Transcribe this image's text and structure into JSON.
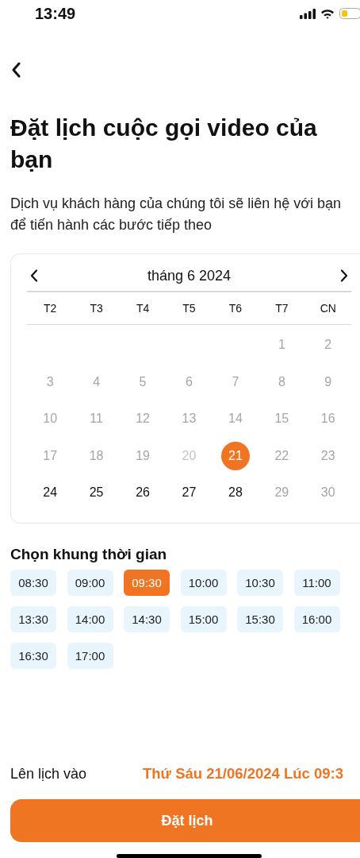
{
  "status_bar": {
    "time": "13:49"
  },
  "title": "Đặt lịch cuộc gọi video của bạn",
  "subtitle": "Dịch vụ khách hàng của chúng tôi sẽ liên hệ với bạn để tiến hành các bước tiếp theo",
  "calendar": {
    "month": "tháng 6 2024",
    "weekdays": [
      "T2",
      "T3",
      "T4",
      "T5",
      "T6",
      "T7",
      "CN"
    ],
    "days": [
      {
        "kind": "blank"
      },
      {
        "kind": "blank"
      },
      {
        "kind": "blank"
      },
      {
        "kind": "blank"
      },
      {
        "kind": "blank"
      },
      {
        "label": "1",
        "kind": "past",
        "selected": false
      },
      {
        "label": "2",
        "kind": "past",
        "selected": false
      },
      {
        "label": "3",
        "kind": "past",
        "selected": false
      },
      {
        "label": "4",
        "kind": "past",
        "selected": false
      },
      {
        "label": "5",
        "kind": "past",
        "selected": false
      },
      {
        "label": "6",
        "kind": "past",
        "selected": false
      },
      {
        "label": "7",
        "kind": "past",
        "selected": false
      },
      {
        "label": "8",
        "kind": "past",
        "selected": false
      },
      {
        "label": "9",
        "kind": "past",
        "selected": false
      },
      {
        "label": "10",
        "kind": "past",
        "selected": false
      },
      {
        "label": "11",
        "kind": "past",
        "selected": false
      },
      {
        "label": "12",
        "kind": "past",
        "selected": false
      },
      {
        "label": "13",
        "kind": "past",
        "selected": false
      },
      {
        "label": "14",
        "kind": "past",
        "selected": false
      },
      {
        "label": "15",
        "kind": "past",
        "selected": false
      },
      {
        "label": "16",
        "kind": "past",
        "selected": false
      },
      {
        "label": "17",
        "kind": "past",
        "selected": false
      },
      {
        "label": "18",
        "kind": "past",
        "selected": false
      },
      {
        "label": "19",
        "kind": "past",
        "selected": false
      },
      {
        "label": "20",
        "kind": "faint",
        "selected": false
      },
      {
        "label": "21",
        "kind": "open",
        "selected": true
      },
      {
        "label": "22",
        "kind": "past",
        "selected": false
      },
      {
        "label": "23",
        "kind": "past",
        "selected": false
      },
      {
        "label": "24",
        "kind": "open",
        "selected": false
      },
      {
        "label": "25",
        "kind": "open",
        "selected": false
      },
      {
        "label": "26",
        "kind": "open",
        "selected": false
      },
      {
        "label": "27",
        "kind": "open",
        "selected": false
      },
      {
        "label": "28",
        "kind": "open",
        "selected": false
      },
      {
        "label": "29",
        "kind": "past",
        "selected": false
      },
      {
        "label": "30",
        "kind": "past",
        "selected": false
      }
    ]
  },
  "time_section": {
    "heading": "Chọn khung thời gian",
    "slots": [
      {
        "label": "08:30",
        "selected": false
      },
      {
        "label": "09:00",
        "selected": false
      },
      {
        "label": "09:30",
        "selected": true
      },
      {
        "label": "10:00",
        "selected": false
      },
      {
        "label": "10:30",
        "selected": false
      },
      {
        "label": "11:00",
        "selected": false
      },
      {
        "label": "13:30",
        "selected": false
      },
      {
        "label": "14:00",
        "selected": false
      },
      {
        "label": "14:30",
        "selected": false
      },
      {
        "label": "15:00",
        "selected": false
      },
      {
        "label": "15:30",
        "selected": false
      },
      {
        "label": "16:00",
        "selected": false
      },
      {
        "label": "16:30",
        "selected": false
      },
      {
        "label": "17:00",
        "selected": false
      }
    ]
  },
  "summary": {
    "label": "Lên lịch vào",
    "value": "Thứ Sáu 21/06/2024 Lúc 09:3"
  },
  "submit_button": "Đặt lịch"
}
